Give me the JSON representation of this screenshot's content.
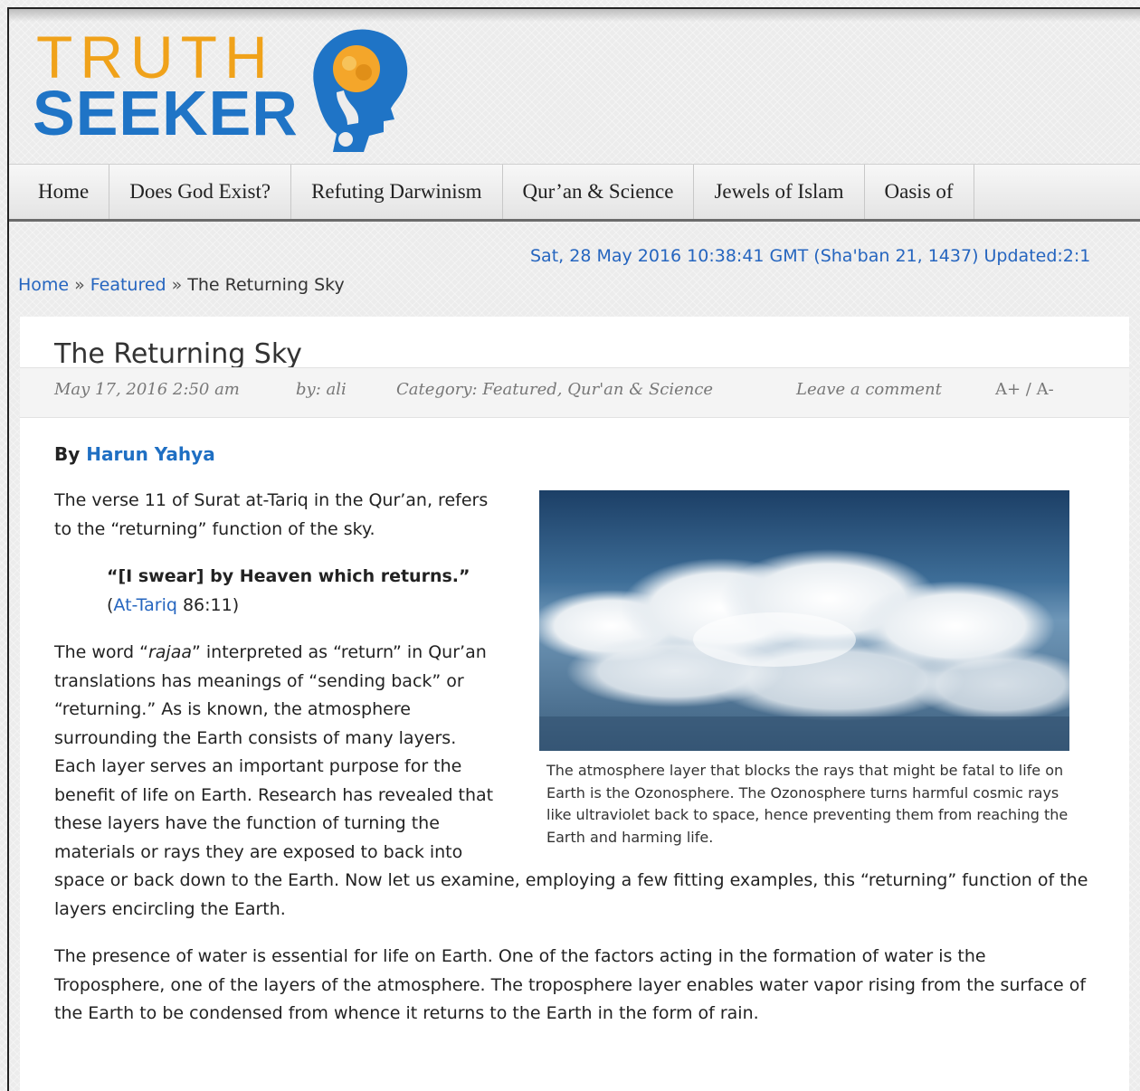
{
  "logo": {
    "word1": "TRUTH",
    "word2": "SEEKER",
    "alt": "Truth Seeker"
  },
  "nav": [
    "Home",
    "Does God Exist?",
    "Refuting Darwinism",
    "Qur’an & Science",
    "Jewels of Islam",
    "Oasis of"
  ],
  "dateline": "Sat, 28 May 2016 10:38:41 GMT (Sha'ban 21, 1437) Updated:2:1",
  "breadcrumb": {
    "home": "Home",
    "sep": "»",
    "featured": "Featured",
    "current": "The Returning Sky"
  },
  "article": {
    "title": "The Returning Sky",
    "meta": {
      "date": "May 17, 2016 2:50 am",
      "author": "by: ali",
      "category": "Category: Featured, Qur'an & Science",
      "comment": "Leave a comment",
      "fontsize": "A+ / A-"
    },
    "byline_prefix": "By",
    "byline_author": "Harun Yahya",
    "para1": "The verse 11 of Surat at-Tariq in the Qur’an, refers to the “returning” function of the sky.",
    "quote_text": "“[I swear] by Heaven which returns.”",
    "quote_ref_link": "At-Tariq",
    "quote_ref_num": "86:11",
    "para2_a": "The word “",
    "para2_term": "rajaa",
    "para2_b": "” interpreted as “return” in Qur’an translations has meanings of “sending back” or “returning.” As is known, the atmosphere surrounding the Earth consists of many layers. Each layer serves an important purpose for the benefit of life on Earth. Research has revealed that these layers have the function of turning the materials or rays they are exposed to back into space or back down to the Earth. Now let us examine, employing a few fitting examples, this “returning” function of the layers encircling the Earth.",
    "para3": "The presence of water is essential for life on Earth. One of the factors acting in the formation of water is the Troposphere, one of the layers of the atmosphere. The troposphere layer enables water vapor rising from the surface of the Earth to be condensed from whence it returns to the Earth in the form of rain.",
    "figure_caption": "The atmosphere layer that blocks the rays that might be fatal to life on Earth is the Ozonosphere. The Ozonosphere turns harmful cosmic rays like ultraviolet back to space, hence preventing them from reaching the Earth and harming life."
  },
  "colors": {
    "brand_orange": "#f0a21a",
    "brand_blue": "#1f74c6",
    "link": "#2565bf"
  }
}
